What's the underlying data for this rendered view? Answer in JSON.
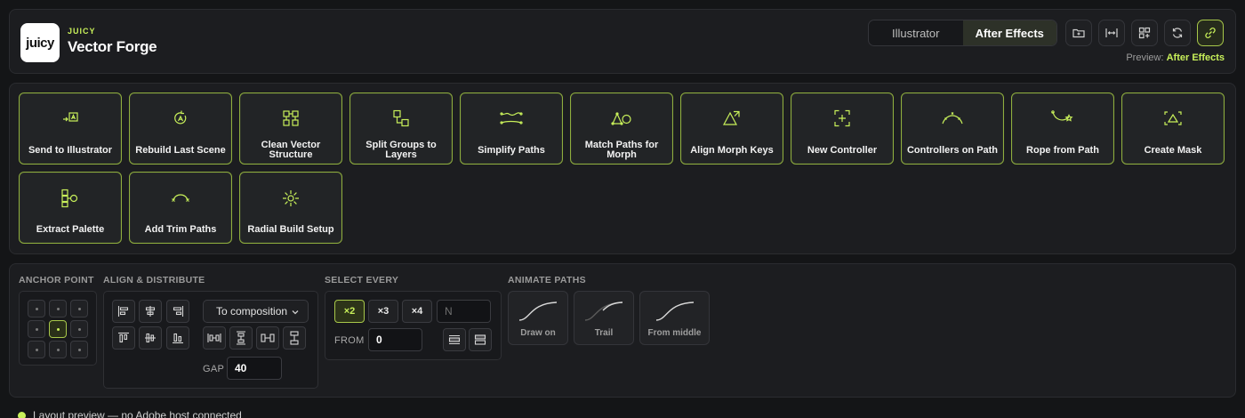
{
  "header": {
    "logo_text": "juicy",
    "brand_small": "JUICY",
    "title": "Vector Forge",
    "host_tabs": [
      {
        "label": "Illustrator",
        "active": false
      },
      {
        "label": "After Effects",
        "active": true
      }
    ],
    "icon_buttons": [
      "folder-open-icon",
      "fit-width-icon",
      "layout-grid-icon",
      "refresh-icon",
      "link-icon"
    ],
    "preview_prefix": "Preview:",
    "preview_value": "After Effects"
  },
  "actions": [
    {
      "label": "Send to Illustrator",
      "icon": "send-to-illustrator-icon"
    },
    {
      "label": "Rebuild Last Scene",
      "icon": "rebuild-icon"
    },
    {
      "label": "Clean Vector Structure",
      "icon": "clean-structure-icon"
    },
    {
      "label": "Split Groups to Layers",
      "icon": "split-groups-icon"
    },
    {
      "label": "Simplify Paths",
      "icon": "simplify-paths-icon"
    },
    {
      "label": "Match Paths for Morph",
      "icon": "match-paths-icon"
    },
    {
      "label": "Align Morph Keys",
      "icon": "align-morph-icon"
    },
    {
      "label": "New Controller",
      "icon": "new-controller-icon"
    },
    {
      "label": "Controllers on Path",
      "icon": "controllers-path-icon"
    },
    {
      "label": "Rope from Path",
      "icon": "rope-path-icon"
    },
    {
      "label": "Create Mask",
      "icon": "create-mask-icon"
    },
    {
      "label": "Extract Palette",
      "icon": "extract-palette-icon"
    },
    {
      "label": "Add Trim Paths",
      "icon": "trim-paths-icon"
    },
    {
      "label": "Radial Build Setup",
      "icon": "radial-build-icon"
    }
  ],
  "tools": {
    "anchor": {
      "label": "ANCHOR POINT",
      "selected_index": 4
    },
    "align": {
      "label": "ALIGN & DISTRIBUTE",
      "relative_to": "To composition",
      "gap_label": "GAP",
      "gap_value": "40"
    },
    "select_every": {
      "label": "SELECT EVERY",
      "options": [
        "×2",
        "×3",
        "×4"
      ],
      "selected": "×2",
      "custom_placeholder": "N",
      "from_label": "FROM",
      "from_value": "0"
    },
    "animate_paths": {
      "label": "ANIMATE PATHS",
      "modes": [
        "Draw on",
        "Trail",
        "From middle"
      ]
    }
  },
  "status": {
    "text": "Layout preview — no Adobe host connected"
  },
  "colors": {
    "accent": "#c8f05a",
    "background": "#141517",
    "panel": "#1c1d20"
  }
}
